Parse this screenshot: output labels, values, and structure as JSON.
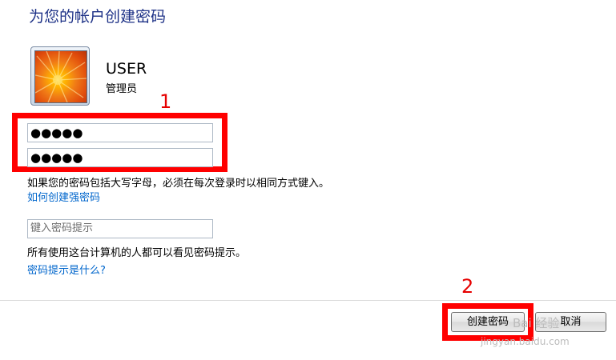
{
  "header": {
    "title": "为您的帐户创建密码"
  },
  "account": {
    "username": "USER",
    "role": "管理员"
  },
  "annotations": {
    "step1": "1",
    "step2": "2",
    "highlight_color": "#ff0000"
  },
  "form": {
    "new_password_value": "●●●●●",
    "confirm_password_value": "●●●●●",
    "case_note": "如果您的密码包括大写字母，必须在每次登录时以相同方式键入。",
    "strong_password_link": "如何创建强密码",
    "hint_placeholder": "键入密码提示",
    "hint_note": "所有使用这台计算机的人都可以看见密码提示。",
    "hint_help_link": "密码提示是什么?"
  },
  "buttons": {
    "create": "创建密码",
    "cancel": "取消"
  },
  "watermark": {
    "brand": "Bai 经验",
    "url": "jingyan.baidu.com"
  },
  "colors": {
    "title": "#1e3287",
    "link": "#0066cc"
  }
}
